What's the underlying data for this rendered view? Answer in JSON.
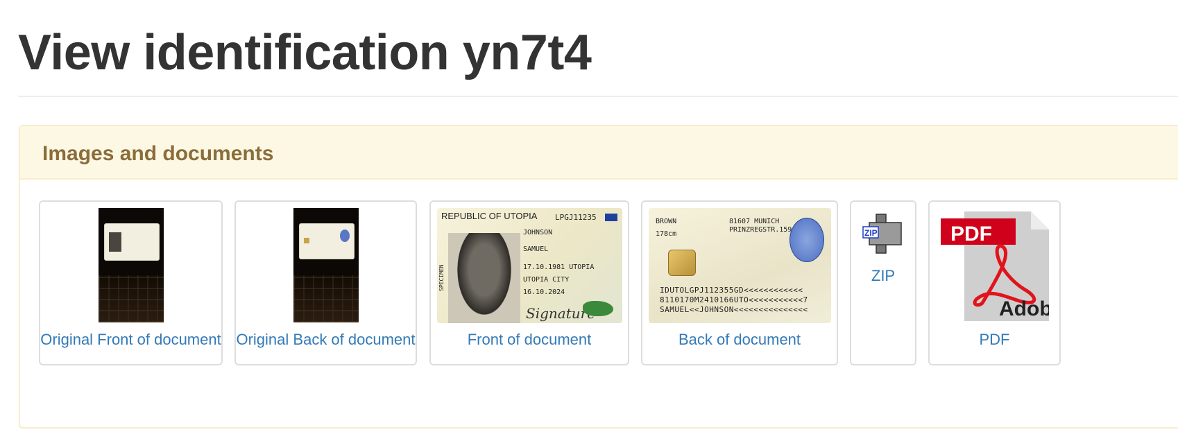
{
  "page": {
    "title": "View identification yn7t4"
  },
  "panel": {
    "title": "Images and documents",
    "items": [
      {
        "caption": "Original Front of document",
        "icon": "document-photo-icon"
      },
      {
        "caption": "Original Back of document",
        "icon": "document-photo-icon"
      },
      {
        "caption": "Front of document",
        "icon": "id-card-front-icon"
      },
      {
        "caption": "Back of document",
        "icon": "id-card-back-icon"
      },
      {
        "caption": "ZIP",
        "icon": "zip-file-icon"
      },
      {
        "caption": "PDF",
        "icon": "pdf-file-icon"
      }
    ]
  },
  "id_front": {
    "country": "REPUBLIC OF UTOPIA",
    "doc_number": "LPGJ11235",
    "surname": "JOHNSON",
    "given_name": "SAMUEL",
    "birth": "17.10.1981 UTOPIA",
    "place": "UTOPIA CITY",
    "expiry": "16.10.2024",
    "specimen": "SPECIMEN",
    "signature": "Signature"
  },
  "id_back": {
    "eye_color": "BROWN",
    "height": "178cm",
    "address_city": "81607 MUNICH",
    "address_street": "PRINZREGSTR.159",
    "mrz_1": "IDUTOLGPJ112355GD<<<<<<<<<<<<",
    "mrz_2": "8110170M2410166UTO<<<<<<<<<<<7",
    "mrz_3": "SAMUEL<<JOHNSON<<<<<<<<<<<<<<<"
  },
  "icons": {
    "zip_text": "ZIP",
    "pdf_text": "PDF",
    "pdf_brand": "Adobe"
  },
  "colors": {
    "link": "#337ab7",
    "panel_heading_bg": "#fcf8e3",
    "panel_heading_text": "#8a6d3b",
    "panel_border": "#faebcc",
    "pdf_red": "#d0021b"
  }
}
